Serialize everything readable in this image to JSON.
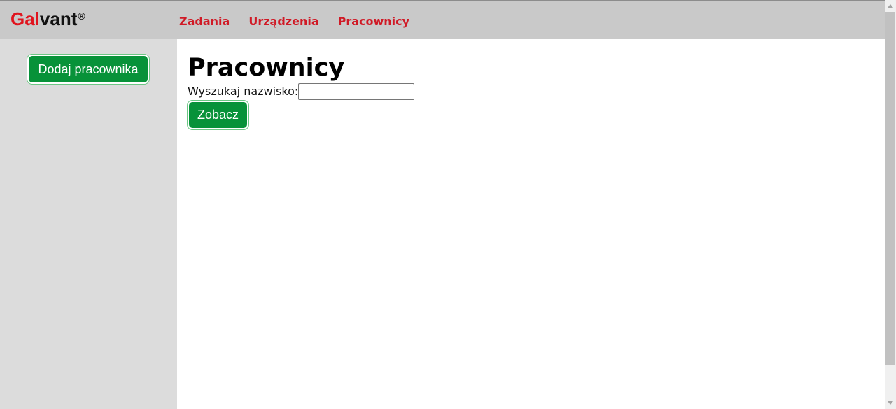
{
  "header": {
    "logo_red": "Gal",
    "logo_dark": "vant",
    "logo_mark": "®",
    "nav": [
      {
        "label": "Zadania"
      },
      {
        "label": "Urządzenia"
      },
      {
        "label": "Pracownicy"
      }
    ]
  },
  "sidebar": {
    "add_button_label": "Dodaj pracownika"
  },
  "main": {
    "title": "Pracownicy",
    "search_label": "Wyszukaj nazwisko:",
    "search_value": "",
    "search_button_label": "Zobacz"
  },
  "colors": {
    "accent_red": "#d01a26",
    "button_green": "#079239",
    "header_bg": "#c9c9c9",
    "sidebar_bg": "#dcdcdc"
  }
}
